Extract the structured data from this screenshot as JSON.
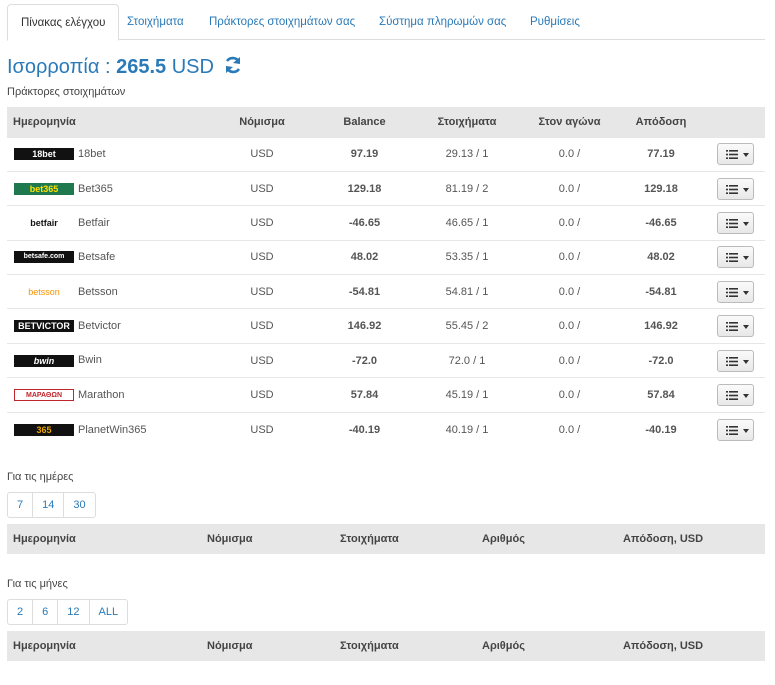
{
  "tabs": [
    {
      "label": "Πίνακας ελέγχου"
    },
    {
      "label": "Στοιχήματα"
    },
    {
      "label": "Πράκτορες στοιχημάτων σας"
    },
    {
      "label": "Σύστημα πληρωμών σας"
    },
    {
      "label": "Ρυθμίσεις"
    }
  ],
  "balance": {
    "label": "Ισορροπία :",
    "amount": "265.5",
    "currency": "USD"
  },
  "subtitle": "Πράκτορες στοιχημάτων",
  "table": {
    "headers": [
      "Ημερομηνία",
      "Νόμισμα",
      "Balance",
      "Στοιχήματα",
      "Στον αγώνα",
      "Απόδοση"
    ],
    "rows": [
      {
        "logo": "18bet",
        "name": "18bet",
        "currency": "USD",
        "balance": "97.19",
        "bets": "29.13 / 1",
        "in_game": "0.0 /",
        "profit": "77.19",
        "sign": "pos"
      },
      {
        "logo": "bet365",
        "name": "Bet365",
        "currency": "USD",
        "balance": "129.18",
        "bets": "81.19 / 2",
        "in_game": "0.0 /",
        "profit": "129.18",
        "sign": "pos"
      },
      {
        "logo": "betfair",
        "name": "Betfair",
        "currency": "USD",
        "balance": "-46.65",
        "bets": "46.65 / 1",
        "in_game": "0.0 /",
        "profit": "-46.65",
        "sign": "neg"
      },
      {
        "logo": "betsafe.com",
        "name": "Betsafe",
        "currency": "USD",
        "balance": "48.02",
        "bets": "53.35 / 1",
        "in_game": "0.0 /",
        "profit": "48.02",
        "sign": "pos"
      },
      {
        "logo": "betsson",
        "name": "Betsson",
        "currency": "USD",
        "balance": "-54.81",
        "bets": "54.81 / 1",
        "in_game": "0.0 /",
        "profit": "-54.81",
        "sign": "neg"
      },
      {
        "logo": "BETVICTOR",
        "name": "Betvictor",
        "currency": "USD",
        "balance": "146.92",
        "bets": "55.45 / 2",
        "in_game": "0.0 /",
        "profit": "146.92",
        "sign": "pos"
      },
      {
        "logo": "bwin",
        "name": "Bwin",
        "currency": "USD",
        "balance": "-72.0",
        "bets": "72.0 / 1",
        "in_game": "0.0 /",
        "profit": "-72.0",
        "sign": "neg"
      },
      {
        "logo": "ΜΑΡΑΘΩΝ",
        "name": "Marathon",
        "currency": "USD",
        "balance": "57.84",
        "bets": "45.19 / 1",
        "in_game": "0.0 /",
        "profit": "57.84",
        "sign": "pos"
      },
      {
        "logo": "365",
        "name": "PlanetWin365",
        "currency": "USD",
        "balance": "-40.19",
        "bets": "40.19 / 1",
        "in_game": "0.0 /",
        "profit": "-40.19",
        "sign": "neg"
      }
    ]
  },
  "days": {
    "label": "Για τις ημέρες",
    "options": [
      "7",
      "14",
      "30"
    ]
  },
  "months": {
    "label": "Για τις μήνες",
    "options": [
      "2",
      "6",
      "12",
      "ALL"
    ]
  },
  "summary_headers": [
    "Ημερομηνία",
    "Νόμισμα",
    "Στοιχήματα",
    "Αριθμός",
    "Απόδοση, USD"
  ],
  "colors": {
    "link": "#2a7ab8",
    "positive": "#2e7a2e",
    "negative": "#a52a2a",
    "header_bg": "#e7e7e7"
  }
}
